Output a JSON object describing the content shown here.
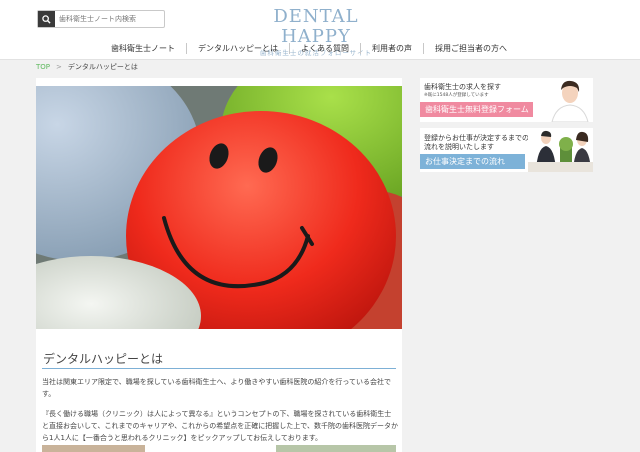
{
  "header": {
    "search_placeholder": "歯科衛生士ノート内検索",
    "logo_main": "DENTAL HAPPY",
    "logo_sub": "歯科衛生士の就活フォローサイト"
  },
  "nav": {
    "items": [
      {
        "label": "歯科衛生士ノート"
      },
      {
        "label": "デンタルハッピーとは"
      },
      {
        "label": "よくある質問"
      },
      {
        "label": "利用者の声"
      },
      {
        "label": "採用ご担当者の方へ"
      }
    ]
  },
  "breadcrumb": {
    "home": "TOP",
    "current": "デンタルハッピーとは"
  },
  "main": {
    "section_title": "デンタルハッピーとは",
    "paragraph_1": "当社は関東エリア限定で、職場を探している歯科衛生士へ、より働きやすい歯科医院の紹介を行っている会社です。",
    "paragraph_2": "『長く働ける職場（クリニック）は人によって異なる』というコンセプトの下、職場を探されている歯科衛生士と直接お会いして、これまでのキャリアや、これからの希望点を正確に把握した上で、数千院の歯科医院データから1人1人に【一番合うと思われるクリニック】をピックアップしてお伝えしております。"
  },
  "sidebar": {
    "banner_1": {
      "text": "歯科衛生士の求人を探す",
      "note": "※既に1548人が登録しています",
      "button": "歯科衛生士無料登録フォーム"
    },
    "banner_2": {
      "line_1": "登録からお仕事が決定するまでの",
      "line_2": "流れを説明いたします",
      "button": "お仕事決定までの流れ"
    }
  },
  "colors": {
    "accent_blue": "#7db2d8",
    "accent_pink": "#f08aa0",
    "breadcrumb_green": "#5cb85c",
    "balloon_red": "#ee2a1e"
  }
}
